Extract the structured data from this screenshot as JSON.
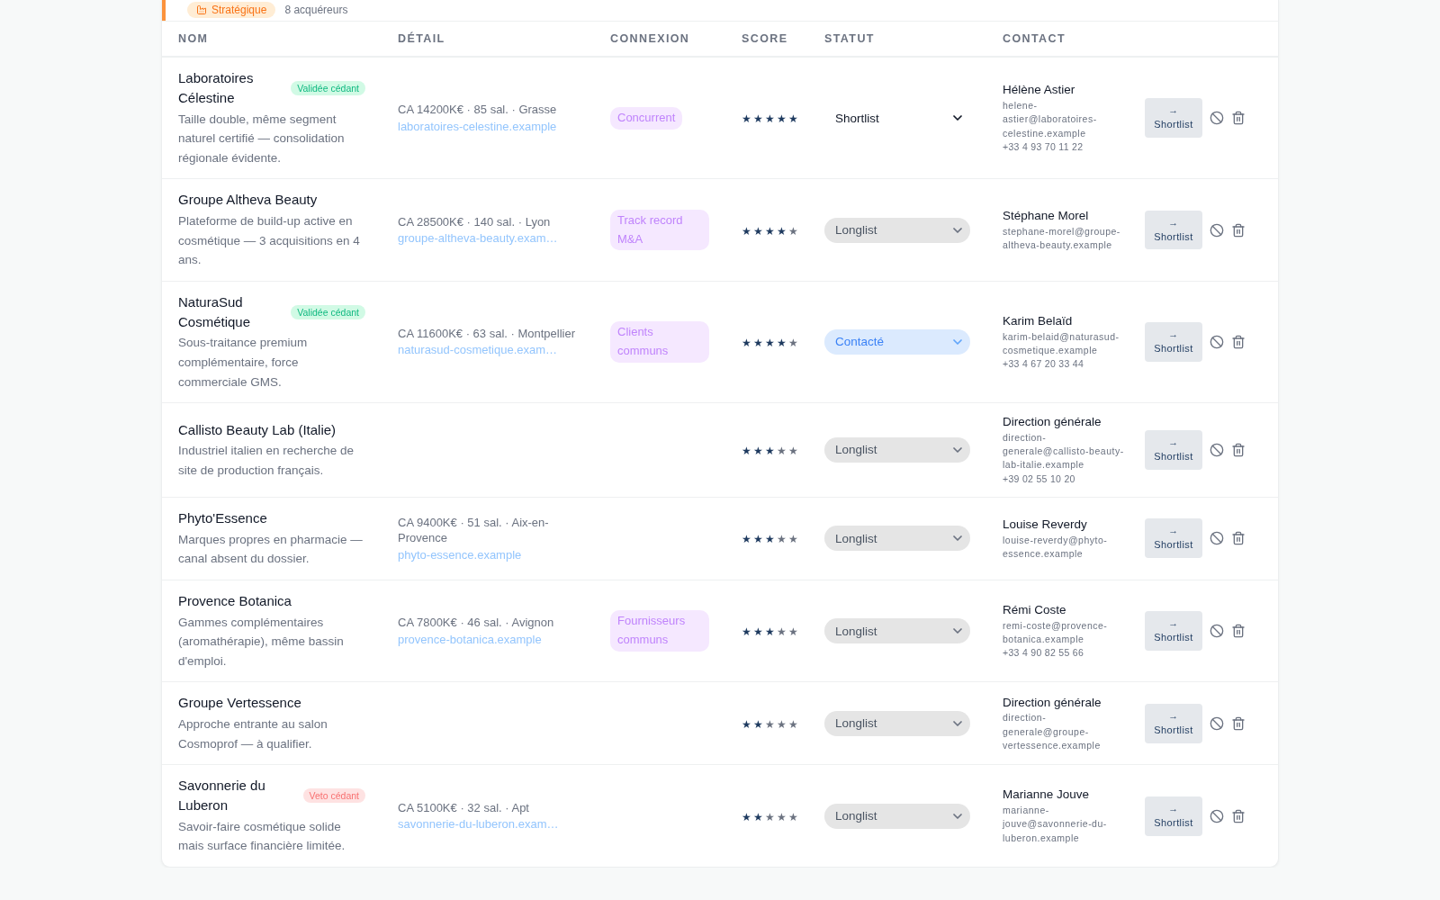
{
  "segment": {
    "badge": "Stratégique",
    "count": "8 acquéreurs"
  },
  "table": {
    "columns": [
      "NOM",
      "DÉTAIL",
      "CONNEXION",
      "SCORE",
      "STATUT",
      "CONTACT"
    ],
    "rows": [
      {
        "name": "Laboratoires Célestine",
        "badge": {
          "label": "Validée cédant",
          "kind": "validated"
        },
        "description": "Taille double, même segment naturel certifié — consolidation régionale évidente.",
        "detail": "CA 14200K€ · 85 sal. · Grasse",
        "website": "laboratoires-celestine.example",
        "connection": "Concurrent",
        "stars": 5,
        "status": {
          "value": "Shortlist",
          "kind": "shortlist"
        },
        "contact": {
          "name": "Hélène Astier",
          "email": "helene-astier@laboratoires-celestine.example",
          "phone": "+33 4 93 70 11 22"
        },
        "action": "→ Shortlist"
      },
      {
        "name": "Groupe Altheva Beauty",
        "description": "Plateforme de build-up active en cosmétique — 3 acquisitions en 4 ans.",
        "detail": "CA 28500K€ · 140 sal. · Lyon",
        "website": "groupe-altheva-beauty.exam…",
        "connection": "Track record M&A",
        "stars": 4,
        "status": {
          "value": "Longlist",
          "kind": "longlist"
        },
        "contact": {
          "name": "Stéphane Morel",
          "email": "stephane-morel@groupe-altheva-beauty.example"
        },
        "action": "→ Shortlist"
      },
      {
        "name": "NaturaSud Cosmétique",
        "badge": {
          "label": "Validée cédant",
          "kind": "validated"
        },
        "description": "Sous-traitance premium complémentaire, force commerciale GMS.",
        "detail": "CA 11600K€ · 63 sal. · Montpellier",
        "website": "naturasud-cosmetique.exam…",
        "connection": "Clients communs",
        "stars": 4,
        "status": {
          "value": "Contacté",
          "kind": "contacted"
        },
        "contact": {
          "name": "Karim Belaïd",
          "email": "karim-belaid@naturasud-cosmetique.example",
          "phone": "+33 4 67 20 33 44"
        },
        "action": "→ Shortlist"
      },
      {
        "name": "Callisto Beauty Lab (Italie)",
        "description": "Industriel italien en recherche de site de production français.",
        "stars": 3,
        "status": {
          "value": "Longlist",
          "kind": "longlist"
        },
        "contact": {
          "name": "Direction générale",
          "email": "direction-generale@callisto-beauty-lab-italie.example",
          "phone": "+39 02 55 10 20"
        },
        "action": "→ Shortlist"
      },
      {
        "name": "Phyto'Essence",
        "description": "Marques propres en pharmacie — canal absent du dossier.",
        "detail": "CA 9400K€ · 51 sal. · Aix-en-Provence",
        "website": "phyto-essence.example",
        "stars": 3,
        "status": {
          "value": "Longlist",
          "kind": "longlist"
        },
        "contact": {
          "name": "Louise Reverdy",
          "email": "louise-reverdy@phyto-essence.example"
        },
        "action": "→ Shortlist"
      },
      {
        "name": "Provence Botanica",
        "description": "Gammes complémentaires (aromathérapie), même bassin d'emploi.",
        "detail": "CA 7800K€ · 46 sal. · Avignon",
        "website": "provence-botanica.example",
        "connection": "Fournisseurs communs",
        "stars": 3,
        "status": {
          "value": "Longlist",
          "kind": "longlist"
        },
        "contact": {
          "name": "Rémi Coste",
          "email": "remi-coste@provence-botanica.example",
          "phone": "+33 4 90 82 55 66"
        },
        "action": "→ Shortlist"
      },
      {
        "name": "Groupe Vertessence",
        "description": "Approche entrante au salon Cosmoprof — à qualifier.",
        "stars": 2,
        "status": {
          "value": "Longlist",
          "kind": "longlist"
        },
        "contact": {
          "name": "Direction générale",
          "email": "direction-generale@groupe-vertessence.example"
        },
        "action": "→ Shortlist"
      },
      {
        "name": "Savonnerie du Luberon",
        "badge": {
          "label": "Veto cédant",
          "kind": "veto"
        },
        "description": "Savoir-faire cosmétique solide mais surface financière limitée.",
        "detail": "CA 5100K€ · 32 sal. · Apt",
        "website": "savonnerie-du-luberon.exam…",
        "stars": 2,
        "status": {
          "value": "Longlist",
          "kind": "longlist"
        },
        "contact": {
          "name": "Marianne Jouve",
          "email": "marianne-jouve@savonnerie-du-luberon.example"
        },
        "action": "→ Shortlist"
      }
    ]
  }
}
